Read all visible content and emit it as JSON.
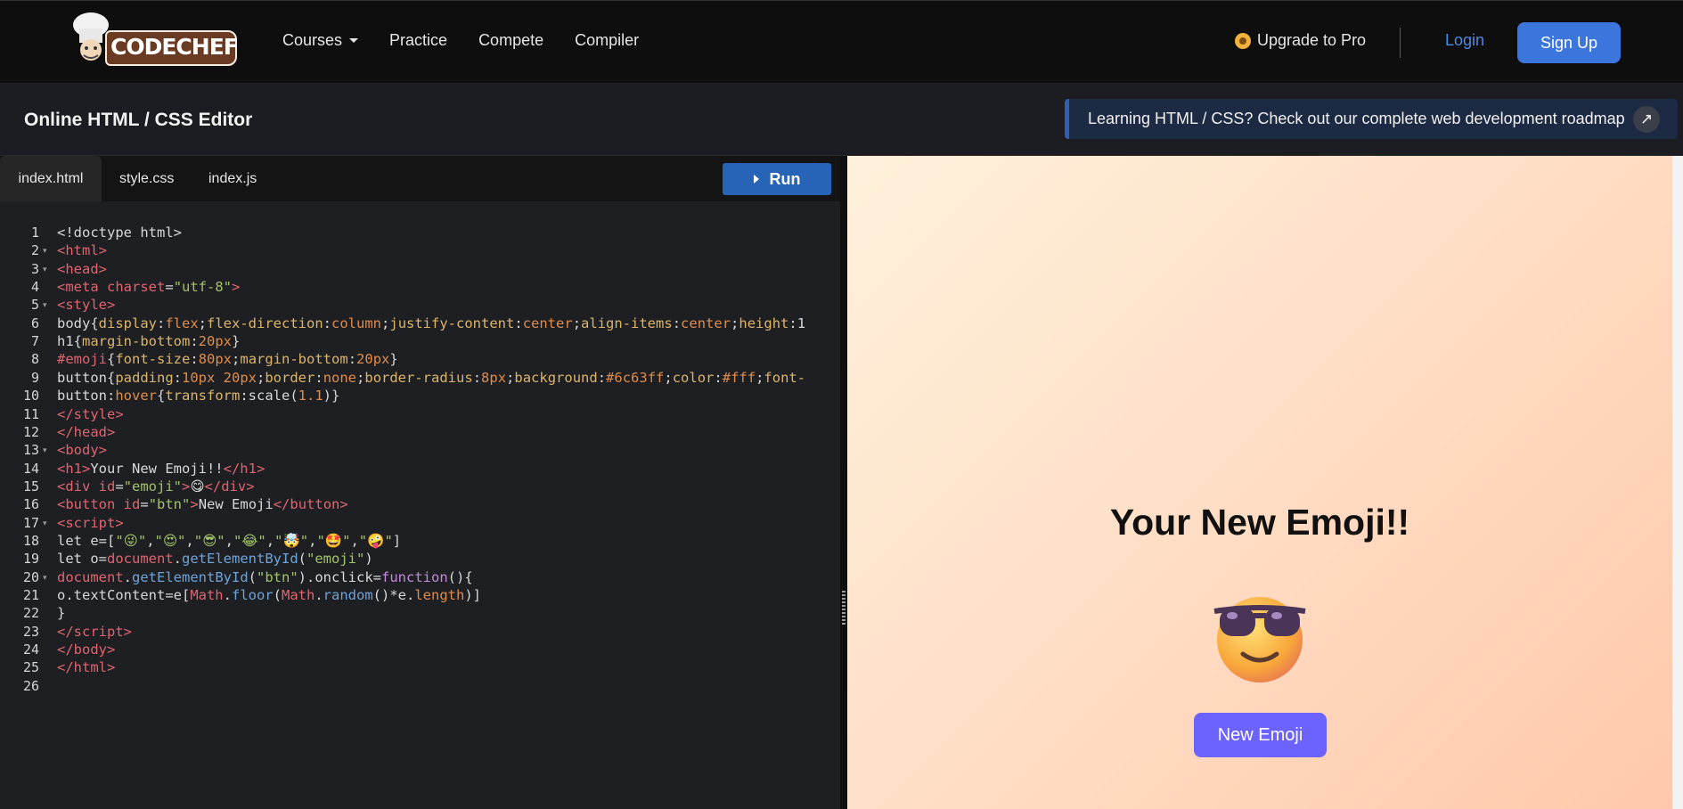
{
  "nav": {
    "logo_text": "CODECHEF",
    "links": [
      "Courses",
      "Practice",
      "Compete",
      "Compiler"
    ],
    "upgrade_label": "Upgrade to Pro",
    "login_label": "Login",
    "signup_label": "Sign Up"
  },
  "titlebar": {
    "title": "Online HTML / CSS Editor",
    "banner": "Learning HTML / CSS? Check out our complete web development roadmap"
  },
  "editor": {
    "tabs": [
      "index.html",
      "style.css",
      "index.js"
    ],
    "active_tab": "index.html",
    "run_label": "Run",
    "line_numbers": [
      "1",
      "2",
      "3",
      "4",
      "5",
      "6",
      "7",
      "8",
      "9",
      "10",
      "11",
      "12",
      "13",
      "14",
      "15",
      "16",
      "17",
      "18",
      "19",
      "20",
      "21",
      "22",
      "23",
      "24",
      "25",
      "26"
    ],
    "folded_lines": [
      2,
      3,
      5,
      13,
      17,
      20
    ],
    "cursor_line": 26
  },
  "preview": {
    "heading": "Your New Emoji!!",
    "button": "New Emoji",
    "emoji_icon": "smiling-face-with-sunglasses-icon"
  },
  "colors": {
    "accent": "#3c76dd",
    "run_button": "#2763b7",
    "preview_button": "#6c63ff"
  }
}
